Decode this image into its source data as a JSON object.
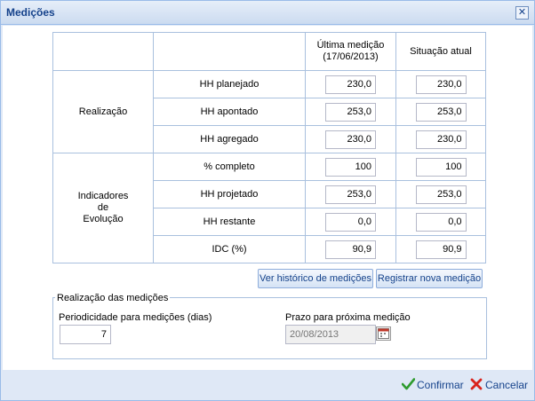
{
  "window": {
    "title": "Medições"
  },
  "table": {
    "headers": {
      "last": "Última medição (17/06/2013)",
      "current": "Situação atual"
    },
    "groups": [
      {
        "label": "Realização",
        "rows": [
          {
            "name": "HH planejado",
            "last": "230,0",
            "current": "230,0"
          },
          {
            "name": "HH apontado",
            "last": "253,0",
            "current": "253,0"
          },
          {
            "name": "HH agregado",
            "last": "230,0",
            "current": "230,0"
          }
        ]
      },
      {
        "label_lines": [
          "Indicadores",
          "de",
          "Evolução"
        ],
        "rows": [
          {
            "name": "% completo",
            "last": "100",
            "current": "100"
          },
          {
            "name": "HH projetado",
            "last": "253,0",
            "current": "253,0"
          },
          {
            "name": "HH restante",
            "last": "0,0",
            "current": "0,0"
          },
          {
            "name": "IDC (%)",
            "last": "90,9",
            "current": "90,9"
          }
        ]
      }
    ]
  },
  "buttons": {
    "history": "Ver histórico de medições",
    "register": "Registrar nova medição"
  },
  "realizacao": {
    "legend": "Realização das medições",
    "periodicity_label": "Periodicidade para medições (dias)",
    "periodicity_value": "7",
    "next_label": "Prazo para próxima medição",
    "next_value": "20/08/2013"
  },
  "footer": {
    "confirm": "Confirmar",
    "cancel": "Cancelar"
  },
  "icons": {
    "close": "close-icon",
    "calendar": "calendar-icon",
    "confirm": "check-icon",
    "cancel": "x-icon"
  },
  "colors": {
    "accent": "#15428b",
    "border": "#99bbe8",
    "background": "#dfe8f6"
  }
}
